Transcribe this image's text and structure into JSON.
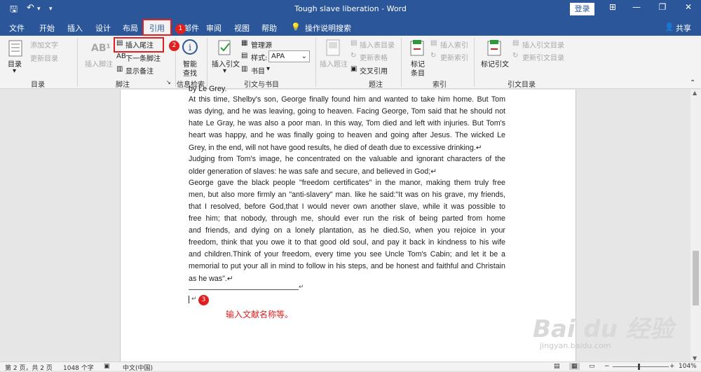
{
  "titlebar": {
    "save": "🖫",
    "undo": "↶",
    "undo_more": "▾",
    "customize": "▾",
    "title": "Tough slave liberation  -  Word",
    "login": "登录",
    "ribbon_opts": "⊞",
    "minimize": "—",
    "restore": "❐",
    "close": "✕"
  },
  "tabs": {
    "file": "文件",
    "home": "开始",
    "insert": "插入",
    "design": "设计",
    "layout": "布局",
    "references": "引用",
    "mailings": "邮件",
    "review": "审阅",
    "view": "视图",
    "help": "帮助",
    "tell_me": "操作说明搜索",
    "share": "共享"
  },
  "ribbon": {
    "toc": {
      "button": "目录",
      "add_text": "添加文字",
      "update": "更新目录",
      "group": "目录"
    },
    "footnotes": {
      "insert_footnote": "插入脚注",
      "insert_endnote": "插入尾注",
      "next_footnote": "下一条脚注",
      "show_notes": "显示备注",
      "group": "脚注"
    },
    "research": {
      "smart_lookup_1": "智能",
      "smart_lookup_2": "查找",
      "group": "信息检索"
    },
    "citations": {
      "insert_citation": "插入引文",
      "manage_sources": "管理源",
      "style_label": "样式:",
      "style_value": "APA",
      "bibliography": "书目",
      "group": "引文与书目"
    },
    "captions": {
      "insert_caption": "插入题注",
      "insert_tof": "插入表目录",
      "update_table": "更新表格",
      "cross_ref": "交叉引用",
      "group": "题注"
    },
    "index": {
      "mark_entry_1": "标记",
      "mark_entry_2": "条目",
      "insert_index": "插入索引",
      "update_index": "更新索引",
      "group": "索引"
    },
    "toa": {
      "mark_citation": "标记引文",
      "insert_toa": "插入引文目录",
      "update_toa": "更新引文目录",
      "group": "引文目录"
    }
  },
  "document": {
    "lines": [
      "by Le Grey.",
      "At this time, Shelby's son, George finally found him and wanted to take him home. But Tom",
      "was dying, and he was leaving, going to heaven. Facing George, Tom said that he should not",
      "hate Le Gray, he was also a poor man. In this way, Tom died and left with injuries. But Tom's",
      "heart was happy, and he was finally going to heaven and going after Jesus. The wicked Le",
      "Grey, in the end, will not have good results, he died of death due to excessive drinking.↵",
      "Judging from Tom's image, he concentrated on the valuable and ignorant characters of the",
      "older generation of slaves: he was safe and secure, and believed in God;↵",
      "George gave the black people \"freedom certificates\" in the manor, making them truly free",
      "men, but also more firmly an \"anti-slavery\" man. like he said:\"It was on his grave, my friends,",
      "that I resolved, before God,that I would never own another slave, while it was possible to",
      "free him; that nobody, through me, should ever run the risk of being parted from home",
      "and friends, and dying on a lonely plantation, as he died.So, when you rejoice in your",
      "freedom, think that you owe it to that good old soul, and pay it back in kindness to his wife",
      "and children.Think of your freedom, every time you see Uncle Tom's Cabin; and let it be a",
      "memorial to put your all in mind to follow in his steps, and be honest and faithful and Christain",
      "as he was\".↵"
    ],
    "endnote_separator_mark": "↵",
    "endnote_mark": "↵"
  },
  "annotations": {
    "step1": "1",
    "step2": "2",
    "step3": "3",
    "note": "输入文献名称等。"
  },
  "watermark": {
    "logo": "Bai du 经验",
    "url": "jingyan.baidu.com"
  },
  "status": {
    "page": "第 2 页，共 2 页",
    "words": "1048 个字",
    "language": "中文(中国)",
    "zoom": "104%",
    "zoom_minus": "−",
    "zoom_plus": "+"
  },
  "colors": {
    "title_blue": "#2b579a",
    "annotation_red": "#e02020"
  }
}
